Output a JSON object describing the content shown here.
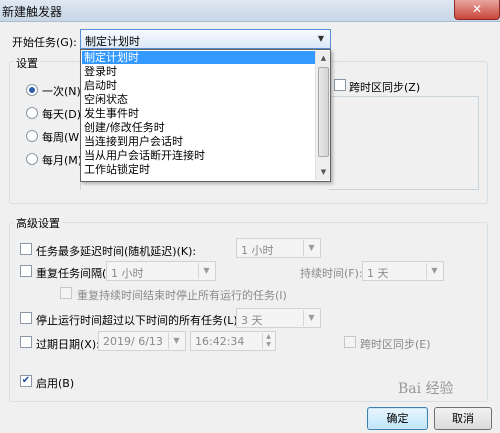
{
  "window": {
    "title": "新建触发器",
    "close_glyph": "✕"
  },
  "begin_task": {
    "label": "开始任务(G):",
    "selected": "制定计划时"
  },
  "dropdown": {
    "items": [
      "制定计划时",
      "登录时",
      "启动时",
      "空闲状态",
      "发生事件时",
      "创建/修改任务时",
      "当连接到用户会话时",
      "当从用户会话断开连接时",
      "工作站锁定时"
    ],
    "selected_index": 0
  },
  "settings": {
    "group_label": "设置",
    "radios": [
      {
        "label": "一次(N)",
        "checked": true
      },
      {
        "label": "每天(D)",
        "checked": false
      },
      {
        "label": "每周(W)",
        "checked": false
      },
      {
        "label": "每月(M)",
        "checked": false
      }
    ],
    "sync_label": "跨时区同步(Z)"
  },
  "advanced": {
    "group_label": "高级设置",
    "delay": {
      "label": "任务最多延迟时间(随机延迟)(K):",
      "value": "1 小时"
    },
    "repeat": {
      "label": "重复任务间隔(P):",
      "value": "1 小时",
      "duration_label": "持续时间(F):",
      "duration_value": "1 天"
    },
    "stop_all": {
      "label": "重复持续时间结束时停止所有运行的任务(I)"
    },
    "stop_longer": {
      "label": "停止运行时间超过以下时间的所有任务(L):",
      "value": "3 天"
    },
    "expire": {
      "label": "过期日期(X):",
      "date": "2019/ 6/13",
      "time": "16:42:34",
      "sync_label": "跨时区同步(E)"
    },
    "enabled": {
      "label": "启用(B)",
      "checked": true
    }
  },
  "buttons": {
    "ok": "确定",
    "cancel": "取消"
  },
  "watermark": "Bai 经验"
}
